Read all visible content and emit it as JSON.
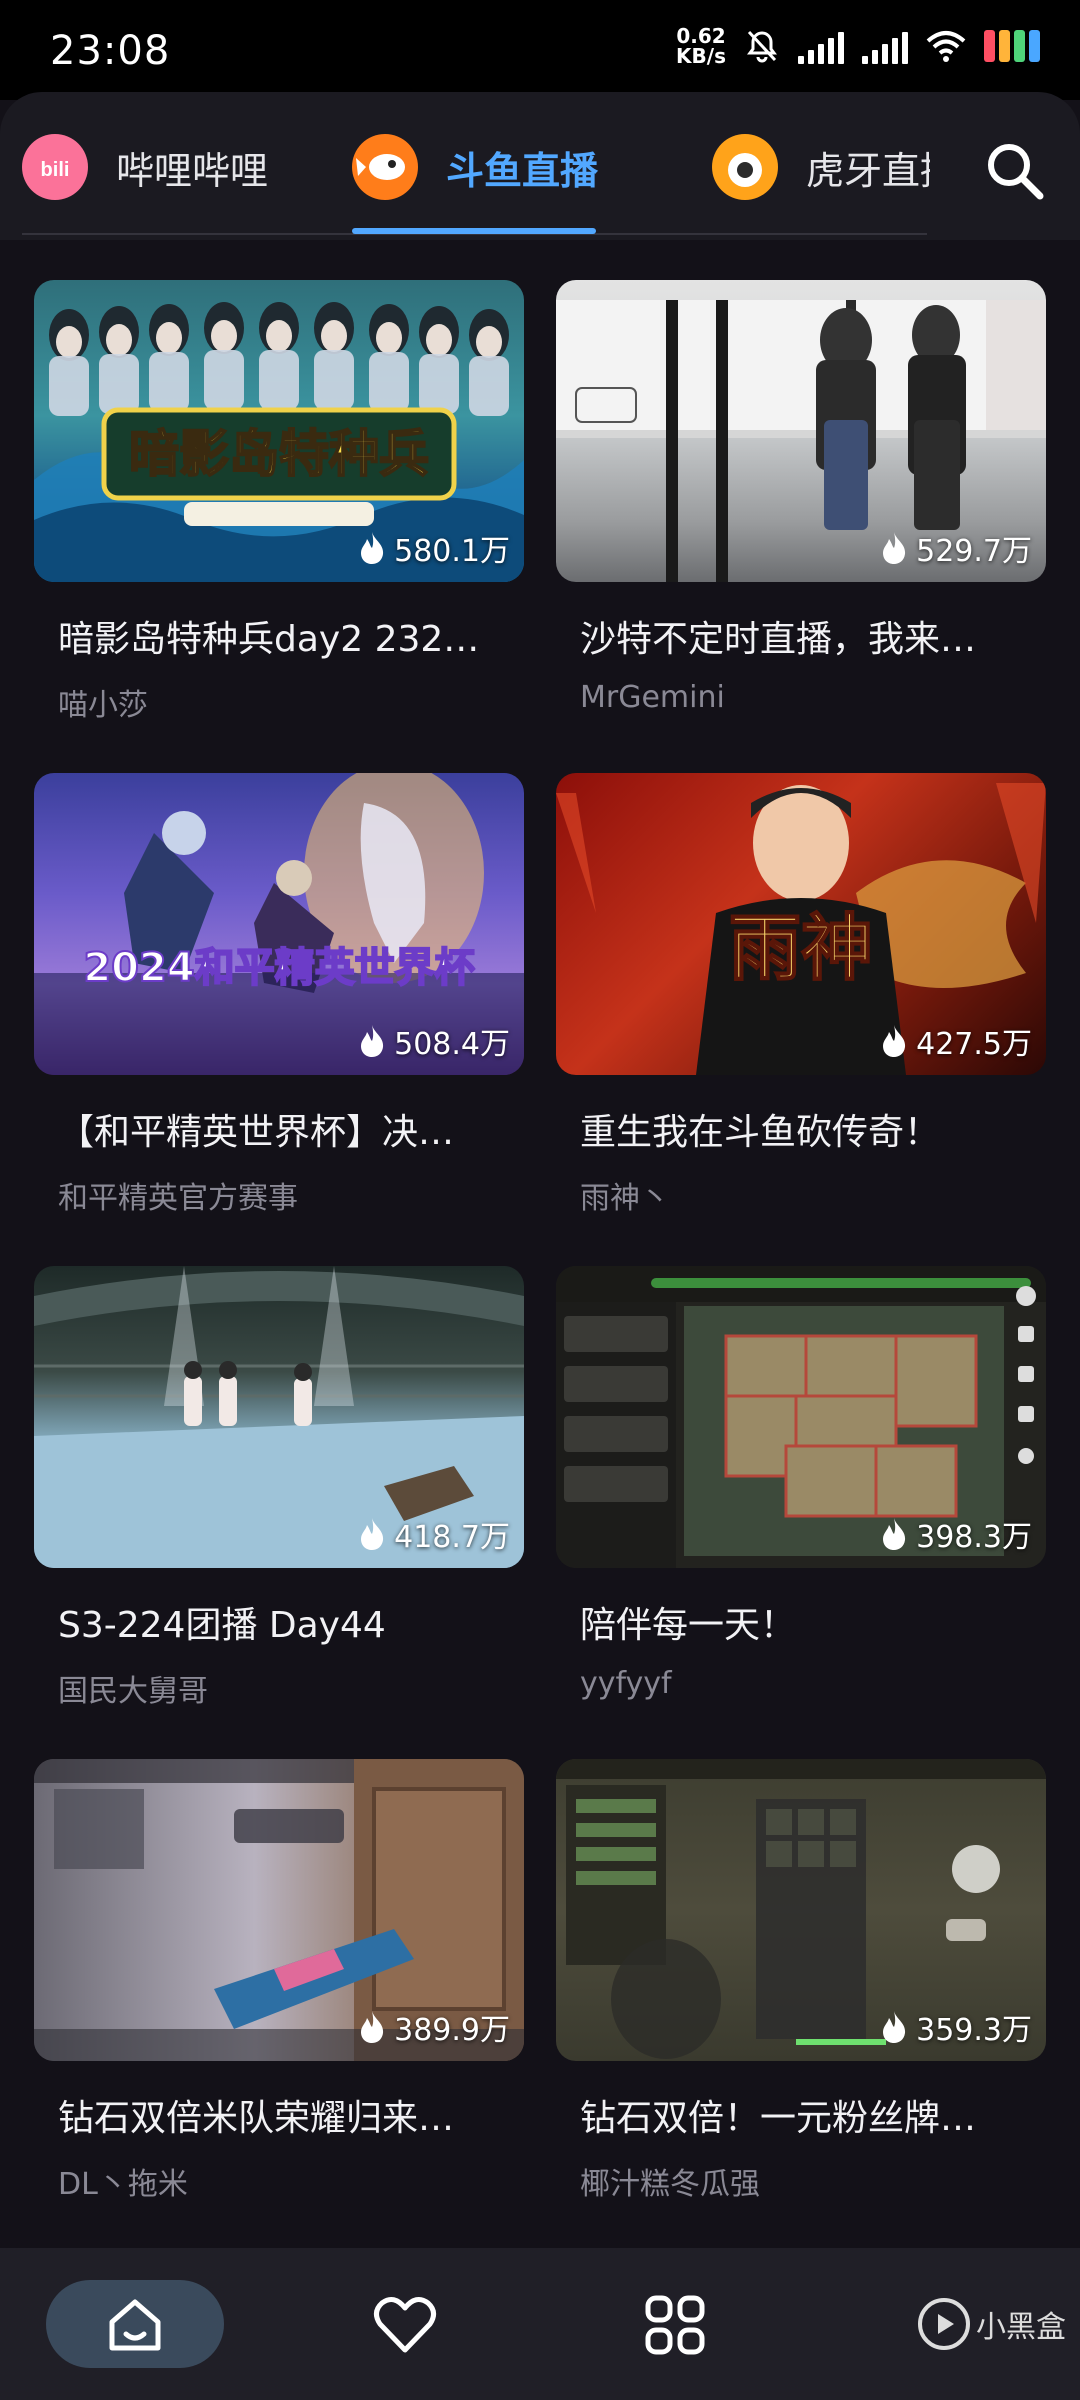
{
  "status_bar": {
    "time": "23:08",
    "net_speed_value": "0.62",
    "net_speed_unit": "KB/s",
    "battery_colors": [
      "#ff4f63",
      "#ffb43a",
      "#4fd37a",
      "#4aa7ff"
    ]
  },
  "tabs": [
    {
      "label": "哔哩哔哩",
      "logo_color": "#fb7299",
      "active": false
    },
    {
      "label": "斗鱼直播",
      "logo_color": "#ff7d1a",
      "active": true
    },
    {
      "label": "虎牙直播",
      "logo_color": "#ffa31a",
      "active": false
    }
  ],
  "cards": [
    {
      "title": "暗影岛特种兵day2 232…",
      "author": "喵小莎",
      "viewers": "580.1万"
    },
    {
      "title": "沙特不定时直播，我来…",
      "author": "MrGemini",
      "viewers": "529.7万"
    },
    {
      "title": "【和平精英世界杯】决…",
      "author": "和平精英官方赛事",
      "viewers": "508.4万"
    },
    {
      "title": "重生我在斗鱼砍传奇！",
      "author": "雨神丶",
      "viewers": "427.5万"
    },
    {
      "title": "S3-224团播 Day44",
      "author": "国民大舅哥",
      "viewers": "418.7万"
    },
    {
      "title": "陪伴每一天！",
      "author": "yyfyyf",
      "viewers": "398.3万"
    },
    {
      "title": "钻石双倍米队荣耀归来…",
      "author": "DL丶拖米",
      "viewers": "389.9万"
    },
    {
      "title": "钻石双倍！一元粉丝牌…",
      "author": "椰汁糕冬瓜强",
      "viewers": "359.3万"
    }
  ],
  "thumb_overlay_text": {
    "card0": "暗影岛特种兵",
    "card2": "2024和平精英世界杯",
    "card3": "雨神"
  },
  "watermark": "小黑盒",
  "colors": {
    "accent": "#52a8ff",
    "background": "#131118"
  }
}
